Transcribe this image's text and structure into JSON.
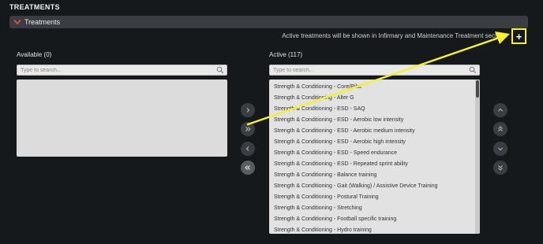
{
  "page": {
    "title": "TREATMENTS"
  },
  "section": {
    "title": "Treatments",
    "icon": "chevron-down-icon"
  },
  "info": {
    "text": "Active treatments will be shown in Infirmary and Maintenance Treatment section",
    "add_label": "+"
  },
  "available": {
    "label": "Available (0)",
    "search_placeholder": "Type to search...",
    "items": []
  },
  "active": {
    "label": "Active (117)",
    "search_placeholder": "Type to search...",
    "items": [
      "Strength & Conditioning - Core/Pilat",
      "Strength & Conditioning - Alter G",
      "Strength & Conditioning - ESD - SAQ",
      "Strength & Conditioning - ESD - Aerobic low intensity",
      "Strength & Conditioning - ESD - Aerobic medium intensity",
      "Strength & Conditioning - ESD - Aerobic high intensity",
      "Strength & Conditioning - ESD - Speed endurance",
      "Strength & Conditioning - ESD - Repeated sprint ability",
      "Strength & Conditioning - Balance training",
      "Strength & Conditioning - Gait (Walking) / Assistive Device Training",
      "Strength & Conditioning - Postural Training",
      "Strength & Conditioning - Stretching",
      "Strength & Conditioning - Football specific training",
      "Strength & Conditioning - Hydro training"
    ]
  },
  "transfer_buttons": [
    {
      "icon": "chevron-right-icon"
    },
    {
      "icon": "double-chevron-right-icon"
    },
    {
      "icon": "chevron-left-icon"
    },
    {
      "icon": "double-chevron-left-icon"
    }
  ],
  "order_buttons": [
    {
      "icon": "chevron-up-icon"
    },
    {
      "icon": "double-chevron-up-icon"
    },
    {
      "icon": "chevron-down-icon"
    },
    {
      "icon": "double-chevron-down-icon"
    }
  ],
  "colors": {
    "background": "#16191c",
    "header": "#3a3e42",
    "accent_chevron": "#e0533a",
    "highlight": "#f5f12a"
  }
}
